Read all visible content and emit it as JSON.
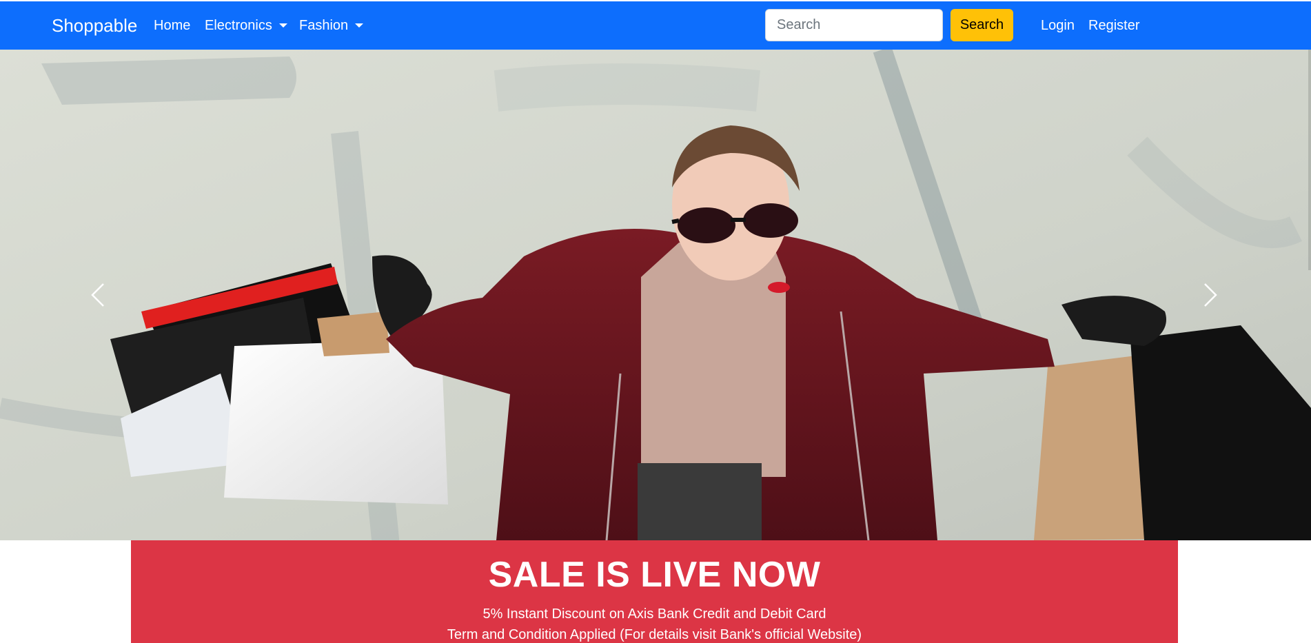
{
  "navbar": {
    "brand": "Shoppable",
    "links": {
      "home": "Home",
      "electronics": "Electronics",
      "fashion": "Fashion",
      "login": "Login",
      "register": "Register"
    },
    "search": {
      "placeholder": "Search",
      "button_label": "Search"
    },
    "colors": {
      "background": "#0d6efd",
      "search_button": "#ffc107"
    }
  },
  "carousel": {
    "controls": {
      "prev_icon": "chevron-left-icon",
      "next_icon": "chevron-right-icon"
    },
    "slide_image": "woman-with-shopping-bags-photo"
  },
  "sale_banner": {
    "title": "SALE IS LIVE NOW",
    "line1": "5% Instant Discount on Axis Bank Credit and Debit Card",
    "line2": "Term and Condition Applied (For details visit Bank's official Website)",
    "color": "#dc3545"
  }
}
